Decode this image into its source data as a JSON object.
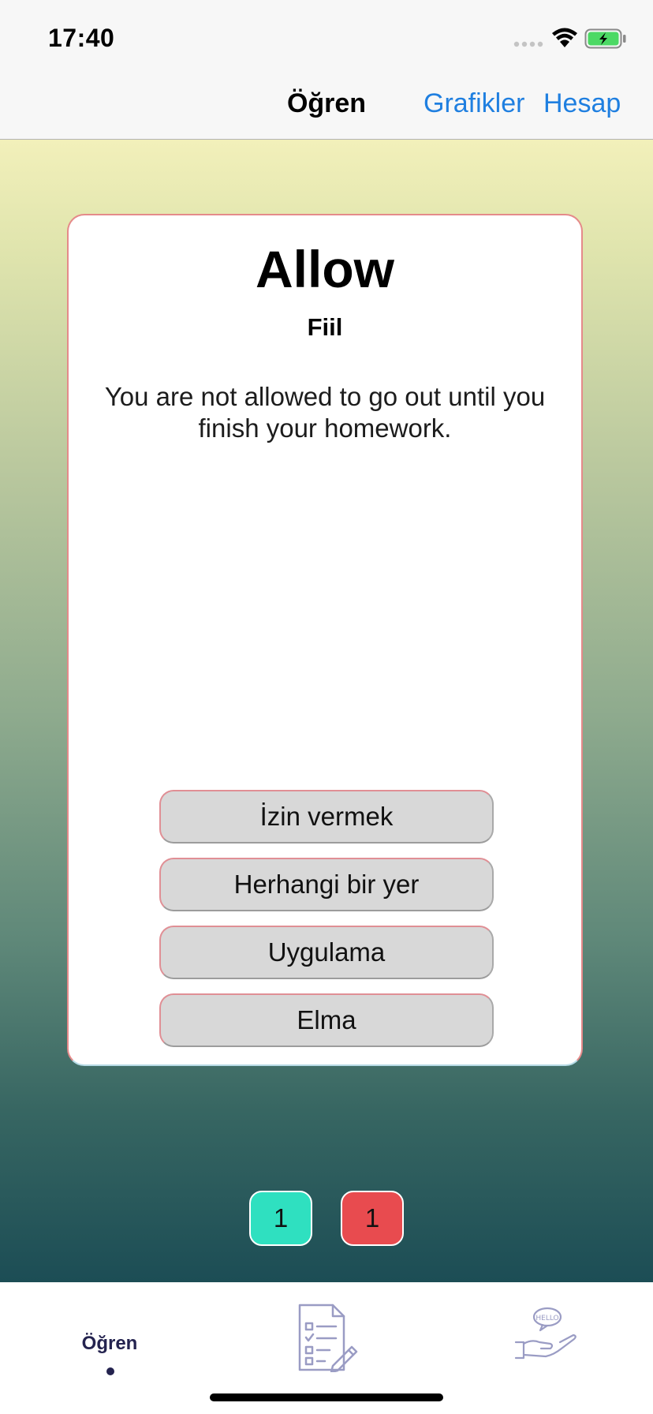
{
  "status_bar": {
    "time": "17:40"
  },
  "nav": {
    "title": "Öğren",
    "charts_label": "Grafikler",
    "account_label": "Hesap"
  },
  "card": {
    "word": "Allow",
    "part_of_speech": "Fiil",
    "example_sentence": "You are not allowed to go out until you finish your homework.",
    "options": [
      "İzin vermek",
      "Herhangi bir yer",
      "Uygulama",
      "Elma"
    ]
  },
  "score": {
    "correct": "1",
    "wrong": "1"
  },
  "tab_bar": {
    "learn_label": "Öğren"
  },
  "colors": {
    "link": "#1f7fe0",
    "correct": "#2fe0c0",
    "wrong": "#e84b4f",
    "tab_active": "#24234f"
  }
}
